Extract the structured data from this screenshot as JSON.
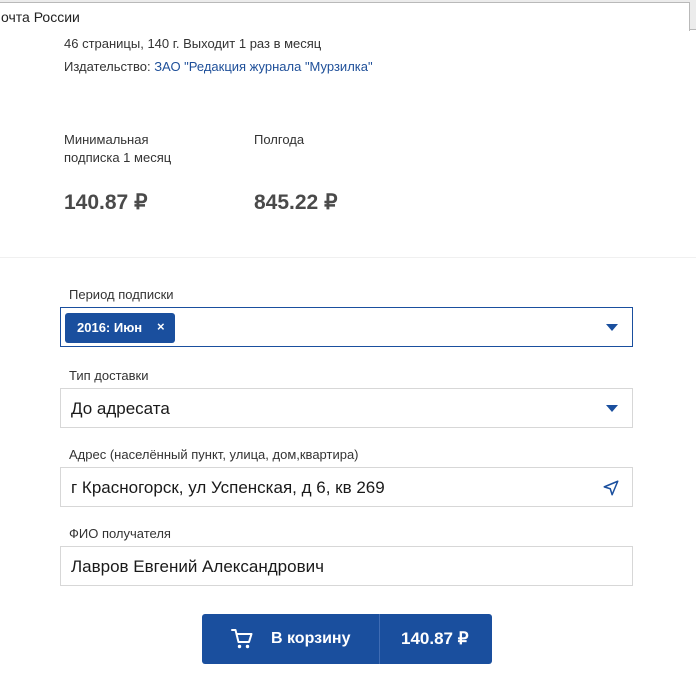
{
  "browser": {
    "tab_title": "очта России"
  },
  "product": {
    "pages_info": "46 страницы, 140 г. Выходит 1 раз в месяц",
    "publisher_label": "Издательство:",
    "publisher_name": "ЗАО \"Редакция журнала \"Мурзилка\""
  },
  "prices": {
    "min_label_line1": "Минимальная",
    "min_label_line2": "подписка 1 месяц",
    "min_value": "140.87 ₽",
    "half_year_label": "Полгода",
    "half_year_value": "845.22 ₽"
  },
  "form": {
    "period": {
      "label": "Период подписки",
      "chip": "2016: Июн",
      "chip_remove": "×"
    },
    "delivery": {
      "label": "Тип доставки",
      "value": "До адресата"
    },
    "address": {
      "label": "Адрес (населённый пункт, улица, дом,квартира)",
      "value": "г Красногорск, ул Успенская, д 6, кв 269"
    },
    "recipient": {
      "label": "ФИО получателя",
      "value": "Лавров Евгений Александрович"
    }
  },
  "cart": {
    "label": "В корзину",
    "price": "140.87 ₽"
  },
  "colors": {
    "accent": "#1a4f9e",
    "link": "#1e4f99",
    "price_text": "#4a4a4a"
  },
  "icons": {
    "caret": "chevron-down-icon",
    "geo": "navigation-arrow-icon",
    "cart": "shopping-cart-icon"
  }
}
